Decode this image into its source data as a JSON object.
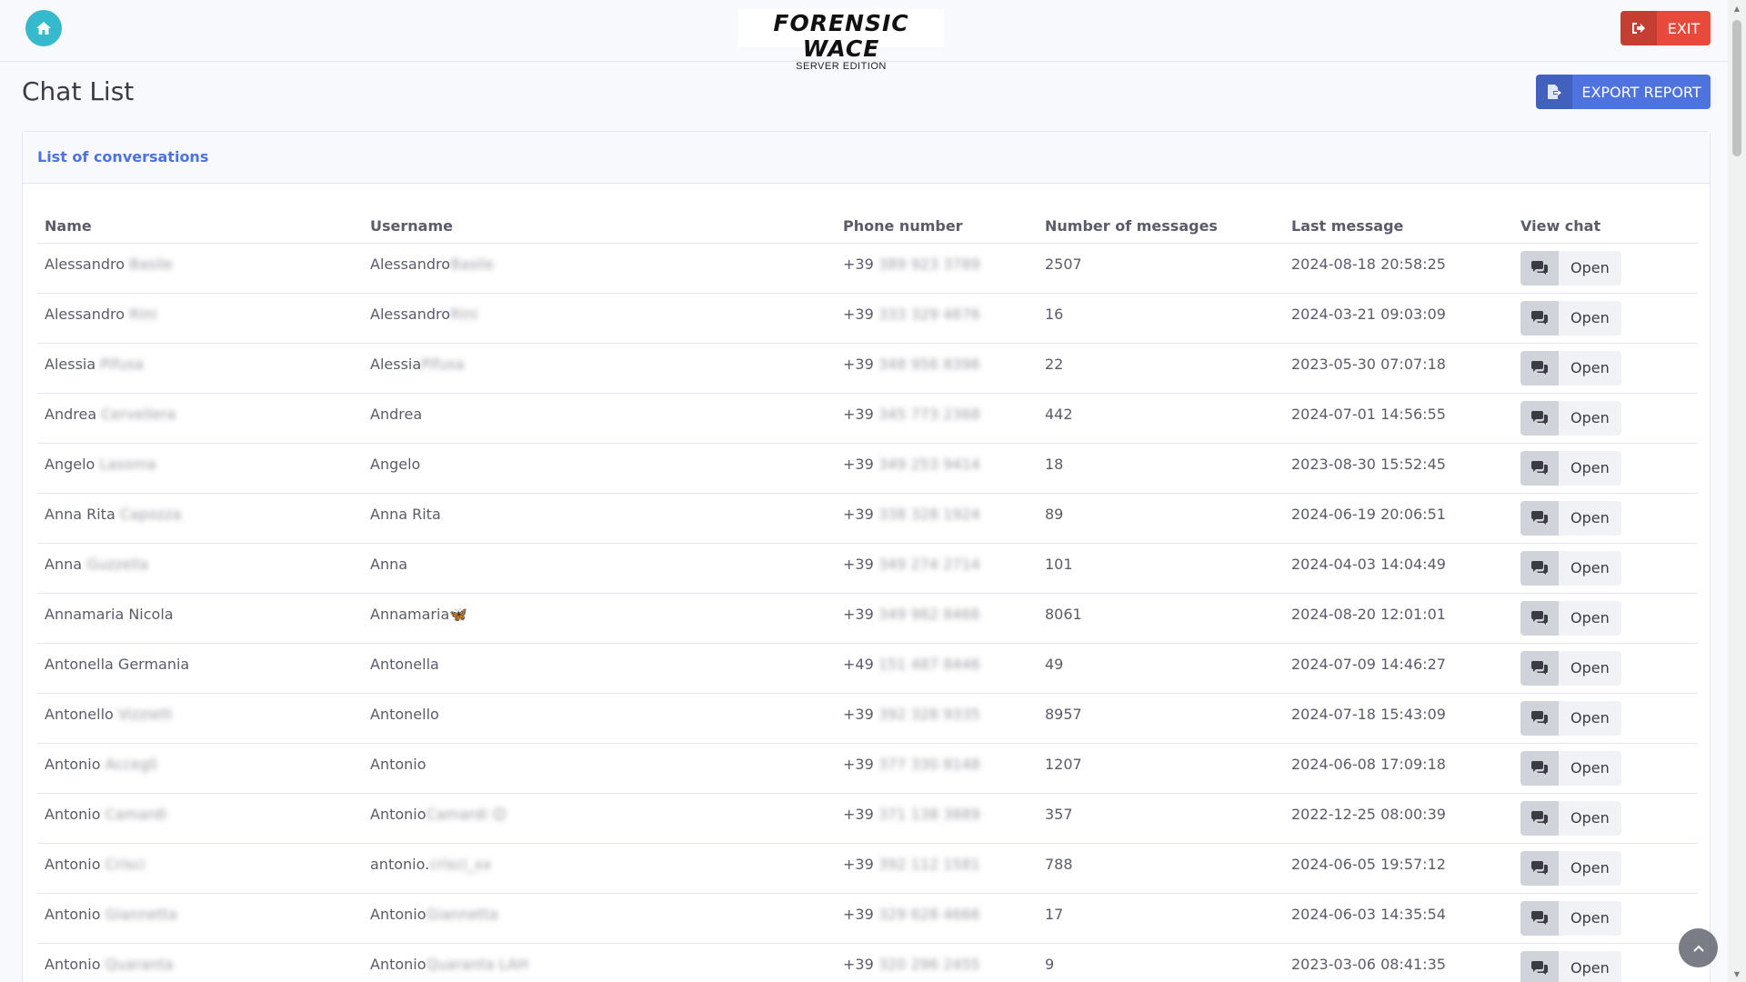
{
  "header": {
    "logo_title": "FORENSIC WACE",
    "logo_subtitle": "SERVER EDITION",
    "exit_label": "EXIT"
  },
  "page": {
    "title": "Chat List",
    "export_label": "EXPORT REPORT"
  },
  "card": {
    "title": "List of conversations"
  },
  "table": {
    "columns": [
      "Name",
      "Username",
      "Phone number",
      "Number of messages",
      "Last message",
      "View chat"
    ],
    "open_label": "Open",
    "rows": [
      {
        "name": "Alessandro",
        "name_blur": "Basile",
        "username": "Alessandro",
        "username_blur": "Basile",
        "prefix": "+39",
        "phone_blur": "389 923 3789",
        "messages": "2507",
        "last": "2024-08-18 20:58:25"
      },
      {
        "name": "Alessandro",
        "name_blur": "Rini",
        "username": "Alessandro",
        "username_blur": "Rini",
        "prefix": "+39",
        "phone_blur": "333 329 4676",
        "messages": "16",
        "last": "2024-03-21 09:03:09"
      },
      {
        "name": "Alessia",
        "name_blur": "Pifusa",
        "username": "Alessia",
        "username_blur": "Pifusa",
        "prefix": "+39",
        "phone_blur": "348 956 8396",
        "messages": "22",
        "last": "2023-05-30 07:07:18"
      },
      {
        "name": "Andrea",
        "name_blur": "Cervellera",
        "username": "Andrea",
        "username_blur": "",
        "prefix": "+39",
        "phone_blur": "345 773 2368",
        "messages": "442",
        "last": "2024-07-01 14:56:55"
      },
      {
        "name": "Angelo",
        "name_blur": "Lasoma",
        "username": "Angelo",
        "username_blur": "",
        "prefix": "+39",
        "phone_blur": "349 253 9414",
        "messages": "18",
        "last": "2023-08-30 15:52:45"
      },
      {
        "name": "Anna Rita",
        "name_blur": "Capozza",
        "username": "Anna Rita",
        "username_blur": "",
        "prefix": "+39",
        "phone_blur": "338 328 1924",
        "messages": "89",
        "last": "2024-06-19 20:06:51"
      },
      {
        "name": "Anna",
        "name_blur": "Guzzella",
        "username": "Anna",
        "username_blur": "",
        "prefix": "+39",
        "phone_blur": "349 274 2714",
        "messages": "101",
        "last": "2024-04-03 14:04:49"
      },
      {
        "name": "Annamaria Nicola",
        "name_blur": "",
        "username": "Annamaria🦋",
        "username_blur": "",
        "prefix": "+39",
        "phone_blur": "349 962 8466",
        "messages": "8061",
        "last": "2024-08-20 12:01:01"
      },
      {
        "name": "Antonella Germania",
        "name_blur": "",
        "username": "Antonella",
        "username_blur": "",
        "prefix": "+49",
        "phone_blur": "151 487 8446",
        "messages": "49",
        "last": "2024-07-09 14:46:27"
      },
      {
        "name": "Antonello",
        "name_blur": "Vizzielli",
        "username": "Antonello",
        "username_blur": "",
        "prefix": "+39",
        "phone_blur": "392 328 9335",
        "messages": "8957",
        "last": "2024-07-18 15:43:09"
      },
      {
        "name": "Antonio",
        "name_blur": "Acceglì",
        "username": "Antonio",
        "username_blur": "",
        "prefix": "+39",
        "phone_blur": "377 330 8148",
        "messages": "1207",
        "last": "2024-06-08 17:09:18"
      },
      {
        "name": "Antonio",
        "name_blur": "Camardi",
        "username": "Antonio",
        "username_blur": "Camardi 😊",
        "prefix": "+39",
        "phone_blur": "371 138 3889",
        "messages": "357",
        "last": "2022-12-25 08:00:39"
      },
      {
        "name": "Antonio",
        "name_blur": "Crisci",
        "username": "antonio.",
        "username_blur": "crisci_xx",
        "prefix": "+39",
        "phone_blur": "392 112 1581",
        "messages": "788",
        "last": "2024-06-05 19:57:12"
      },
      {
        "name": "Antonio",
        "name_blur": "Giannetta",
        "username": "Antonio",
        "username_blur": "Giannetta",
        "prefix": "+39",
        "phone_blur": "329 628 4666",
        "messages": "17",
        "last": "2024-06-03 14:35:54"
      },
      {
        "name": "Antonio",
        "name_blur": "Quaranta",
        "username": "Antonio",
        "username_blur": "Quaranta LAH",
        "prefix": "+39",
        "phone_blur": "320 296 2455",
        "messages": "9",
        "last": "2023-03-06 08:41:35"
      }
    ]
  }
}
